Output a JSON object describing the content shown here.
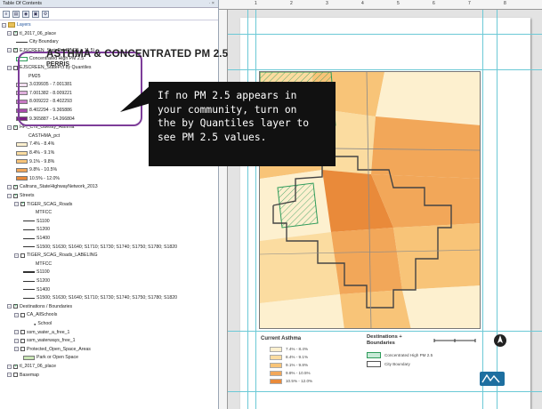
{
  "toc": {
    "title": "Table Of Contents",
    "controls": "∙ ×",
    "toolbar_icons": [
      "list-by-drawing-order-icon",
      "list-by-source-icon",
      "list-by-visibility-icon",
      "list-by-selection-icon",
      "options-icon"
    ],
    "items": [
      {
        "type": "group",
        "label": "Layers"
      },
      {
        "type": "layer",
        "label": "tl_2017_06_place",
        "checked": true
      },
      {
        "type": "line-legend",
        "label": "City Boundary"
      },
      {
        "type": "layer",
        "label": "EJSCREEN_StatePct (PM25 > 11.5)",
        "checked": true
      },
      {
        "type": "swatch-legend",
        "label": "Concentrated High PM 2.5",
        "color": "#ffffff",
        "border": "#2e9b5a"
      },
      {
        "type": "layer",
        "label": "EJSCREEN_StatePct by Quantiles",
        "checked": false
      },
      {
        "type": "field",
        "label": "PM25"
      },
      {
        "type": "swatch-legend",
        "label": "3.039935 - 7.001381",
        "color": "#f3dff0"
      },
      {
        "type": "swatch-legend",
        "label": "7.001382 - 8.009221",
        "color": "#dfb0dc"
      },
      {
        "type": "swatch-legend",
        "label": "8.009222 - 8.402293",
        "color": "#c77ac3"
      },
      {
        "type": "swatch-legend",
        "label": "8.402294 - 9.365886",
        "color": "#a94bab"
      },
      {
        "type": "swatch-legend",
        "label": "9.365887 - 14.266804",
        "color": "#7e1e84"
      },
      {
        "type": "layer",
        "label": "HPI_CTs_Obesity_Asthma",
        "checked": true
      },
      {
        "type": "field",
        "label": "CASTHMA_pct"
      },
      {
        "type": "swatch-legend",
        "label": "7.4% - 8.4%",
        "color": "#fdf0cf"
      },
      {
        "type": "swatch-legend",
        "label": "8.4% - 9.1%",
        "color": "#fbdca0"
      },
      {
        "type": "swatch-legend",
        "label": "9.1% - 9.8%",
        "color": "#f8c478"
      },
      {
        "type": "swatch-legend",
        "label": "9.8% - 10.5%",
        "color": "#f2a759"
      },
      {
        "type": "swatch-legend",
        "label": "10.5% - 12.0%",
        "color": "#e98a3a"
      },
      {
        "type": "layer",
        "label": "Caltrans_StateHighwayNetwork_2013",
        "checked": true
      },
      {
        "type": "group-layer",
        "label": "Streets",
        "checked": true
      },
      {
        "type": "layer",
        "label": "TIGER_SCAG_Roads",
        "checked": true
      },
      {
        "type": "field",
        "label": "MTFCC"
      },
      {
        "type": "line-legend",
        "label": "S1100"
      },
      {
        "type": "line-legend",
        "label": "S1200"
      },
      {
        "type": "line-legend",
        "label": "S1400"
      },
      {
        "type": "line-legend",
        "label": "S1500; S1630; S1640; S1710; S1730; S1740; S1750; S1780; S1820"
      },
      {
        "type": "layer",
        "label": "TIGER_SCAG_Roads_LABELING",
        "checked": false
      },
      {
        "type": "field",
        "label": "MTFCC"
      },
      {
        "type": "thick-line-legend",
        "label": "S1100"
      },
      {
        "type": "line-legend",
        "label": "S1200"
      },
      {
        "type": "line-legend",
        "label": "S1400"
      },
      {
        "type": "line-legend",
        "label": "S1500; S1630; S1640; S1710; S1730; S1740; S1750; S1780; S1820"
      },
      {
        "type": "group-layer",
        "label": "Destinations / Boundaries",
        "checked": true
      },
      {
        "type": "layer",
        "label": "CA_AllSchools",
        "checked": false
      },
      {
        "type": "point-legend",
        "label": "School"
      },
      {
        "type": "layer",
        "label": "ssm_water_a_free_1",
        "checked": false
      },
      {
        "type": "layer",
        "label": "ssm_waterways_free_1",
        "checked": false
      },
      {
        "type": "layer",
        "label": "Protected_Open_Space_Areas",
        "checked": false
      },
      {
        "type": "swatch-legend",
        "label": "Park or Open Space",
        "color": "#c9e6b4"
      },
      {
        "type": "layer",
        "label": "tl_2017_06_place",
        "checked": true
      },
      {
        "type": "layer",
        "label": "Basemap",
        "checked": false
      }
    ]
  },
  "layout_view": {
    "ruler_labels": [
      "1",
      "2",
      "3",
      "4",
      "5",
      "6",
      "7",
      "8"
    ],
    "map_title": "ASTHMA & CONCENTRATED PM 2.5",
    "map_subtitle": "PERRIS",
    "legend": {
      "asthma_title": "Current Asthma",
      "asthma_classes": [
        {
          "label": "7.4% - 8.4%",
          "color": "#fdf0cf"
        },
        {
          "label": "8.4% - 9.1%",
          "color": "#fbdca0"
        },
        {
          "label": "9.1% - 9.8%",
          "color": "#f8c478"
        },
        {
          "label": "9.8% - 10.5%",
          "color": "#f2a759"
        },
        {
          "label": "10.5% - 12.0%",
          "color": "#e98a3a"
        }
      ],
      "dest_title": "Destinations + Boundaries",
      "dest_items": [
        {
          "label": "Concentrated High PM 2.5",
          "color": "#c8ead7",
          "border": "#2e9b5a"
        },
        {
          "label": "City Boundary",
          "color": "#ffffff",
          "border": "#555555"
        }
      ]
    }
  },
  "callout": {
    "lines": [
      "If no PM 2.5 appears in",
      "your community, turn on",
      "the by Quantiles layer to",
      "see PM 2.5 values."
    ]
  },
  "colors": {
    "highlight": "#7d3d99",
    "pm_outline": "#2e9b5a",
    "guides": "#6cc9d6"
  }
}
